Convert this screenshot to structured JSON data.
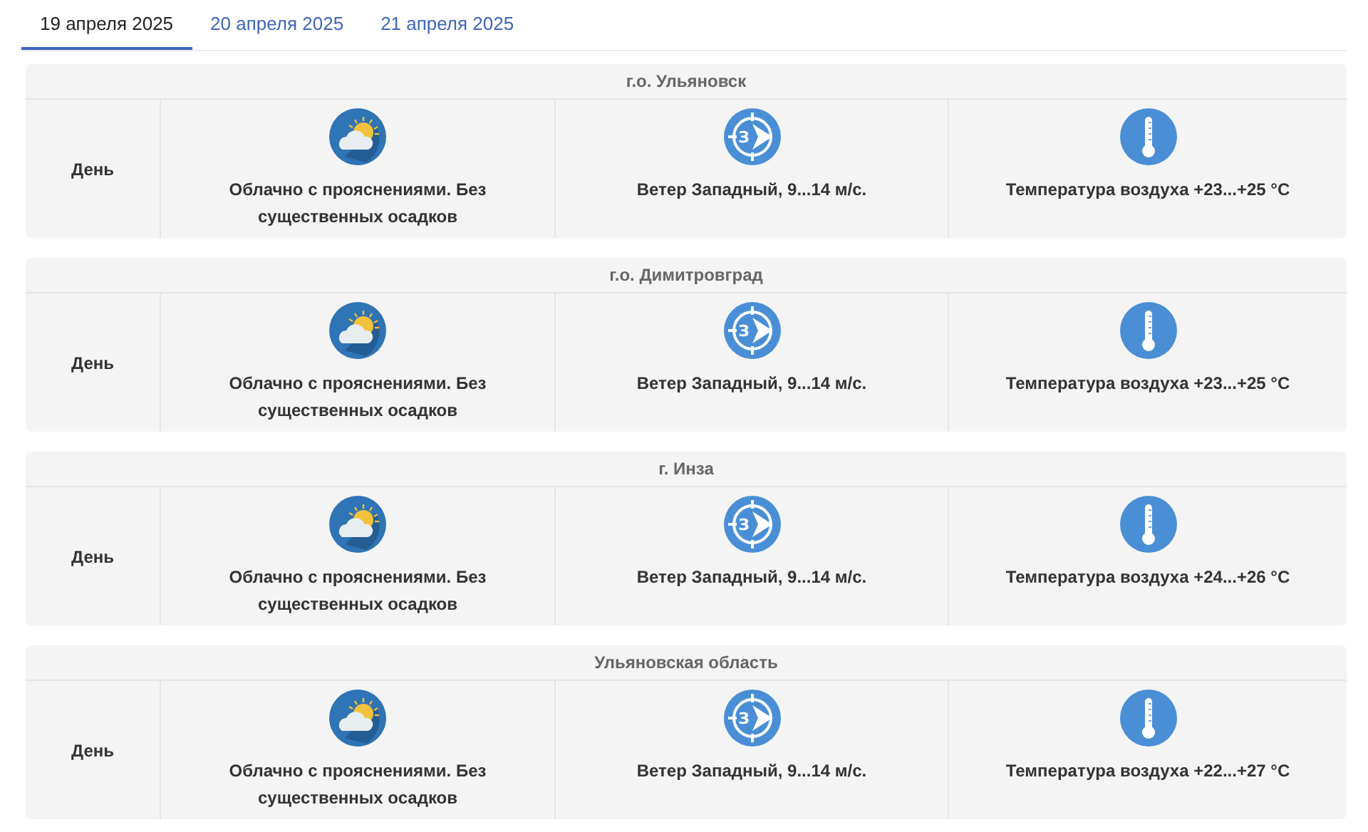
{
  "tabs": [
    {
      "label": "19 апреля 2025",
      "selected": true
    },
    {
      "label": "20 апреля 2025",
      "selected": false
    },
    {
      "label": "21 апреля 2025",
      "selected": false
    }
  ],
  "regions": [
    {
      "name": "г.о. Ульяновск",
      "period": "День",
      "weather": "Облачно с прояснениями. Без существенных осадков",
      "wind_letter": "З",
      "wind": "Ветер Западный, 9...14 м/с.",
      "temperature": "Температура воздуха +23...+25 °С"
    },
    {
      "name": "г.о. Димитровград",
      "period": "День",
      "weather": "Облачно с прояснениями. Без существенных осадков",
      "wind_letter": "З",
      "wind": "Ветер Западный, 9...14 м/с.",
      "temperature": "Температура воздуха +23...+25 °С"
    },
    {
      "name": "г. Инза",
      "period": "День",
      "weather": "Облачно с прояснениями. Без существенных осадков",
      "wind_letter": "З",
      "wind": "Ветер Западный, 9...14 м/с.",
      "temperature": "Температура воздуха +24...+26 °С"
    },
    {
      "name": "Ульяновская область",
      "period": "День",
      "weather": "Облачно с прояснениями. Без существенных осадков",
      "wind_letter": "З",
      "wind": "Ветер Западный, 9...14 м/с.",
      "temperature": "Температура воздуха +22...+27 °С"
    }
  ]
}
